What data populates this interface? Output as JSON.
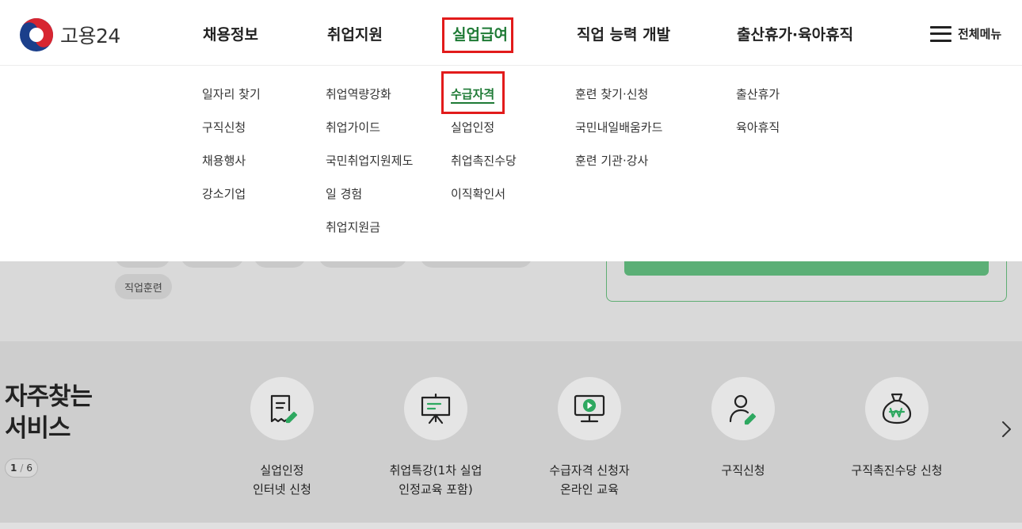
{
  "header": {
    "logo_text": "고용24",
    "nav": [
      "채용정보",
      "취업지원",
      "실업급여",
      "직업 능력 개발",
      "출산휴가·육아휴직"
    ],
    "active_nav": "실업급여",
    "all_menu_label": "전체메뉴"
  },
  "mega_menu": {
    "columns": [
      [
        "일자리 찾기",
        "구직신청",
        "채용행사",
        "강소기업"
      ],
      [
        "취업역량강화",
        "취업가이드",
        "국민취업지원제도",
        "일 경험",
        "취업지원금"
      ],
      [
        "수급자격",
        "실업인정",
        "취업촉진수당",
        "이직확인서"
      ],
      [
        "훈련 찾기·신청",
        "국민내일배움카드",
        "훈련 기관·강사"
      ],
      [
        "출산휴가",
        "육아휴직"
      ]
    ],
    "current_item": "수급자격"
  },
  "background": {
    "tag": "직업훈련"
  },
  "services": {
    "title_line1": "자주찾는",
    "title_line2": "서비스",
    "pager_current": "1",
    "pager_total": "6",
    "items": [
      {
        "label": "실업인정\n인터넷 신청",
        "icon": "document-pen-icon"
      },
      {
        "label": "취업특강(1차 실업\n인정교육 포함)",
        "icon": "presentation-board-icon"
      },
      {
        "label": "수급자격 신청자\n온라인 교육",
        "icon": "video-monitor-icon"
      },
      {
        "label": "구직신청",
        "icon": "person-pen-icon"
      },
      {
        "label": "구직촉진수당 신청",
        "icon": "money-bag-icon"
      }
    ]
  },
  "colors": {
    "accent_green": "#1e7a35",
    "highlight_red": "#e21b1b",
    "icon_green": "#2ea860"
  }
}
